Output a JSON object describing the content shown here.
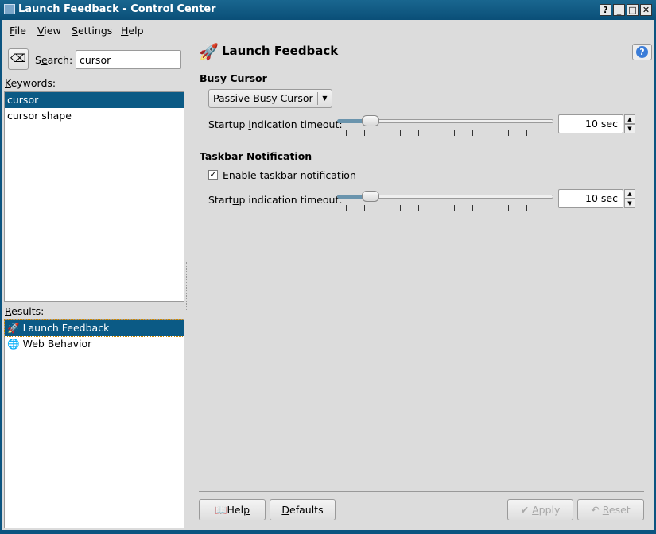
{
  "window": {
    "title": "Launch Feedback - Control Center",
    "buttons": [
      "?",
      "_",
      "□",
      "✕"
    ]
  },
  "menu": [
    {
      "pre": "",
      "u": "F",
      "post": "ile"
    },
    {
      "pre": "",
      "u": "V",
      "post": "iew"
    },
    {
      "pre": "",
      "u": "S",
      "post": "ettings"
    },
    {
      "pre": "",
      "u": "H",
      "post": "elp"
    }
  ],
  "sidebar": {
    "search_label_pre": "S",
    "search_label_u": "e",
    "search_label_post": "arch:",
    "search_value": "cursor",
    "keywords_u": "K",
    "keywords_post": "eywords:",
    "keywords": [
      "cursor",
      "cursor shape"
    ],
    "results_u": "R",
    "results_post": "esults:",
    "results": [
      "Launch Feedback",
      "Web Behavior"
    ]
  },
  "main": {
    "title": "Launch Feedback",
    "busy": {
      "heading_pre": "Bus",
      "heading_u": "y",
      "heading_post": " Cursor",
      "combo": "Passive Busy Cursor",
      "timeout_pre": "Startup ",
      "timeout_u": "i",
      "timeout_post": "ndication timeout:",
      "value": "10 sec",
      "slider_fraction": 0.1
    },
    "taskbar": {
      "heading_pre": "Taskbar ",
      "heading_u": "N",
      "heading_post": "otification",
      "checkbox_pre": "Enable ",
      "checkbox_u": "t",
      "checkbox_post": "askbar notification",
      "checked": true,
      "timeout_pre": "Start",
      "timeout_u": "u",
      "timeout_post": "p indication timeout:",
      "value": "10 sec",
      "slider_fraction": 0.1
    }
  },
  "buttons": {
    "help_pre": "Hel",
    "help_u": "p",
    "defaults_u": "D",
    "defaults_post": "efaults",
    "apply_u": "A",
    "apply_post": "pply",
    "reset_u": "R",
    "reset_post": "eset"
  }
}
